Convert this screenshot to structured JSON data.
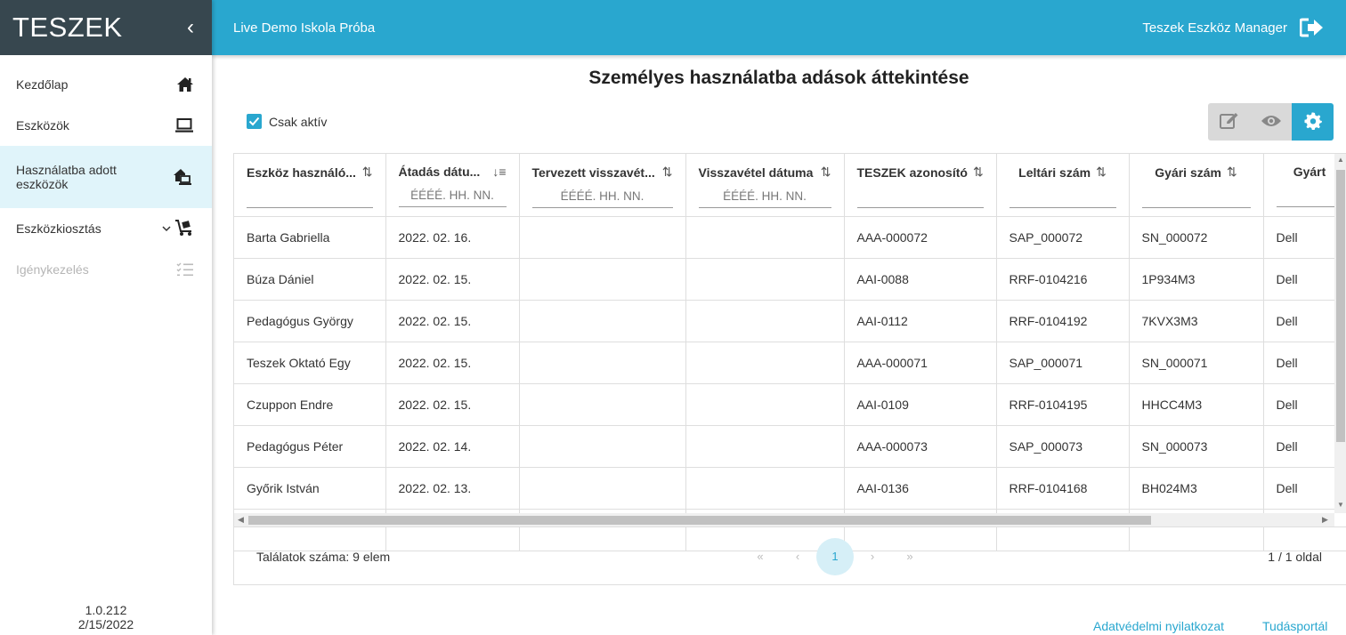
{
  "sidebar": {
    "brand": "TESZEK",
    "collapse_icon": "‹",
    "items": [
      {
        "label": "Kezdőlap",
        "icon": "home-icon"
      },
      {
        "label": "Eszközök",
        "icon": "laptop-icon"
      },
      {
        "label": "Használatba adott eszközök",
        "icon": "home-laptop-icon",
        "active": true
      },
      {
        "label": "Eszközkiosztás",
        "icon": "dolly-icon",
        "expand_icon": "chevron-down-icon"
      },
      {
        "label": "Igénykezelés",
        "icon": "checklist-icon",
        "disabled": true
      }
    ],
    "version": "1.0.212",
    "date": "2/15/2022"
  },
  "header": {
    "school": "Live Demo Iskola Próba",
    "user": "Teszek Eszköz Manager"
  },
  "main": {
    "title": "Személyes használatba adások áttekintése",
    "filter_label": "Csak aktív",
    "filter_checked": true
  },
  "table": {
    "columns": [
      {
        "label": "Eszköz használó...",
        "sort": "⇅",
        "filter": ""
      },
      {
        "label": "Átadás dátu...",
        "sort": "↓≡",
        "filter": "ÉÉÉÉ. HH. NN."
      },
      {
        "label": "Tervezett visszavét...",
        "sort": "⇅",
        "filter": "ÉÉÉÉ. HH. NN."
      },
      {
        "label": "Visszavétel dátuma",
        "sort": "⇅",
        "filter": "ÉÉÉÉ. HH. NN."
      },
      {
        "label": "TESZEK azonosító",
        "sort": "⇅",
        "filter": ""
      },
      {
        "label": "Leltári szám",
        "sort": "⇅",
        "filter": ""
      },
      {
        "label": "Gyári szám",
        "sort": "⇅",
        "filter": ""
      },
      {
        "label": "Gyárt",
        "sort": "",
        "filter": ""
      }
    ],
    "rows": [
      [
        "Barta Gabriella",
        "2022. 02. 16.",
        "",
        "",
        "AAA-000072",
        "SAP_000072",
        "SN_000072",
        "Dell"
      ],
      [
        "Búza Dániel",
        "2022. 02. 15.",
        "",
        "",
        "AAI-0088",
        "RRF-0104216",
        "1P934M3",
        "Dell"
      ],
      [
        "Pedagógus György",
        "2022. 02. 15.",
        "",
        "",
        "AAI-0112",
        "RRF-0104192",
        "7KVX3M3",
        "Dell"
      ],
      [
        "Teszek Oktató Egy",
        "2022. 02. 15.",
        "",
        "",
        "AAA-000071",
        "SAP_000071",
        "SN_000071",
        "Dell"
      ],
      [
        "Czuppon Endre",
        "2022. 02. 15.",
        "",
        "",
        "AAI-0109",
        "RRF-0104195",
        "HHCC4M3",
        "Dell"
      ],
      [
        "Pedagógus Péter",
        "2022. 02. 14.",
        "",
        "",
        "AAA-000073",
        "SAP_000073",
        "SN_000073",
        "Dell"
      ],
      [
        "Győrik István",
        "2022. 02. 13.",
        "",
        "",
        "AAI-0136",
        "RRF-0104168",
        "BH024M3",
        "Dell"
      ],
      [
        "",
        "",
        "",
        "",
        "",
        "",
        "",
        ""
      ]
    ]
  },
  "pagination": {
    "count": "Találatok száma: 9 elem",
    "first": "«",
    "prev": "‹",
    "current": "1",
    "next": "›",
    "last": "»",
    "info": "1 / 1 oldal"
  },
  "footer": {
    "privacy": "Adatvédelmi nyilatkozat",
    "knowledge": "Tudásportál"
  },
  "colors": {
    "accent": "#29a7cf",
    "brand_bg": "#37474f",
    "active_bg": "#e0f4fa"
  }
}
